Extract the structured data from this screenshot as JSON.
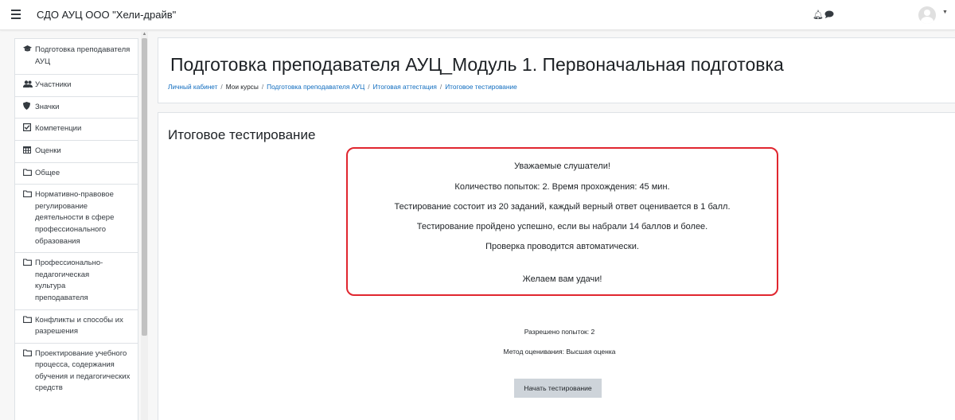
{
  "navbar": {
    "site_name": "СДО АУЦ ООО \"Хели-драйв\"",
    "icons": [
      "menu-icon",
      "bell-icon",
      "chat-icon",
      "user-avatar",
      "caret-down-icon"
    ]
  },
  "sidebar": {
    "items": [
      {
        "icon": "graduation-cap-icon",
        "label": "Подготовка преподавателя АУЦ"
      },
      {
        "icon": "users-icon",
        "label": "Участники"
      },
      {
        "icon": "shield-icon",
        "label": "Значки"
      },
      {
        "icon": "checkbox-icon",
        "label": "Компетенции"
      },
      {
        "icon": "table-icon",
        "label": "Оценки"
      },
      {
        "icon": "folder-icon",
        "label": "Общее"
      },
      {
        "icon": "folder-icon",
        "label": "Нормативно-правовое регулирование деятельности в сфере профессионального образования"
      },
      {
        "icon": "folder-icon",
        "label": "Профессионально-педагогическая культура преподавателя"
      },
      {
        "icon": "folder-icon",
        "label": "Конфликты и способы их разрешения"
      },
      {
        "icon": "folder-icon",
        "label": "Проектирование учебного процесса, содержания обучения и педагогических средств"
      }
    ]
  },
  "header": {
    "title": "Подготовка преподавателя АУЦ_Модуль 1. Первоначальная подготовка",
    "breadcrumb": {
      "dashboard": "Личный кабинет",
      "my_courses": "Мои курсы",
      "course": "Подготовка преподавателя АУЦ",
      "section": "Итоговая аттестация",
      "activity": "Итоговое тестирование",
      "separator": "/"
    }
  },
  "quiz": {
    "title": "Итоговое тестирование",
    "intro": {
      "greeting": "Уважаемые слушатели!",
      "attempts_time": "Количество попыток: 2. Время прохождения: 45 мин.",
      "structure": "Тестирование состоит из 20 заданий, каждый верный ответ оценивается в 1 балл.",
      "pass_condition": "Тестирование пройдено успешно, если вы набрали 14 баллов и более.",
      "check_mode": "Проверка проводится автоматически.",
      "wish": "Желаем вам удачи!"
    },
    "attempts_allowed": "Разрешено попыток: 2",
    "grading_method": "Метод оценивания: Высшая оценка",
    "start_button": "Начать тестирование"
  },
  "colors": {
    "highlight_border": "#e0262f",
    "link": "#0f6cbf",
    "button_bg": "#ced4da"
  }
}
